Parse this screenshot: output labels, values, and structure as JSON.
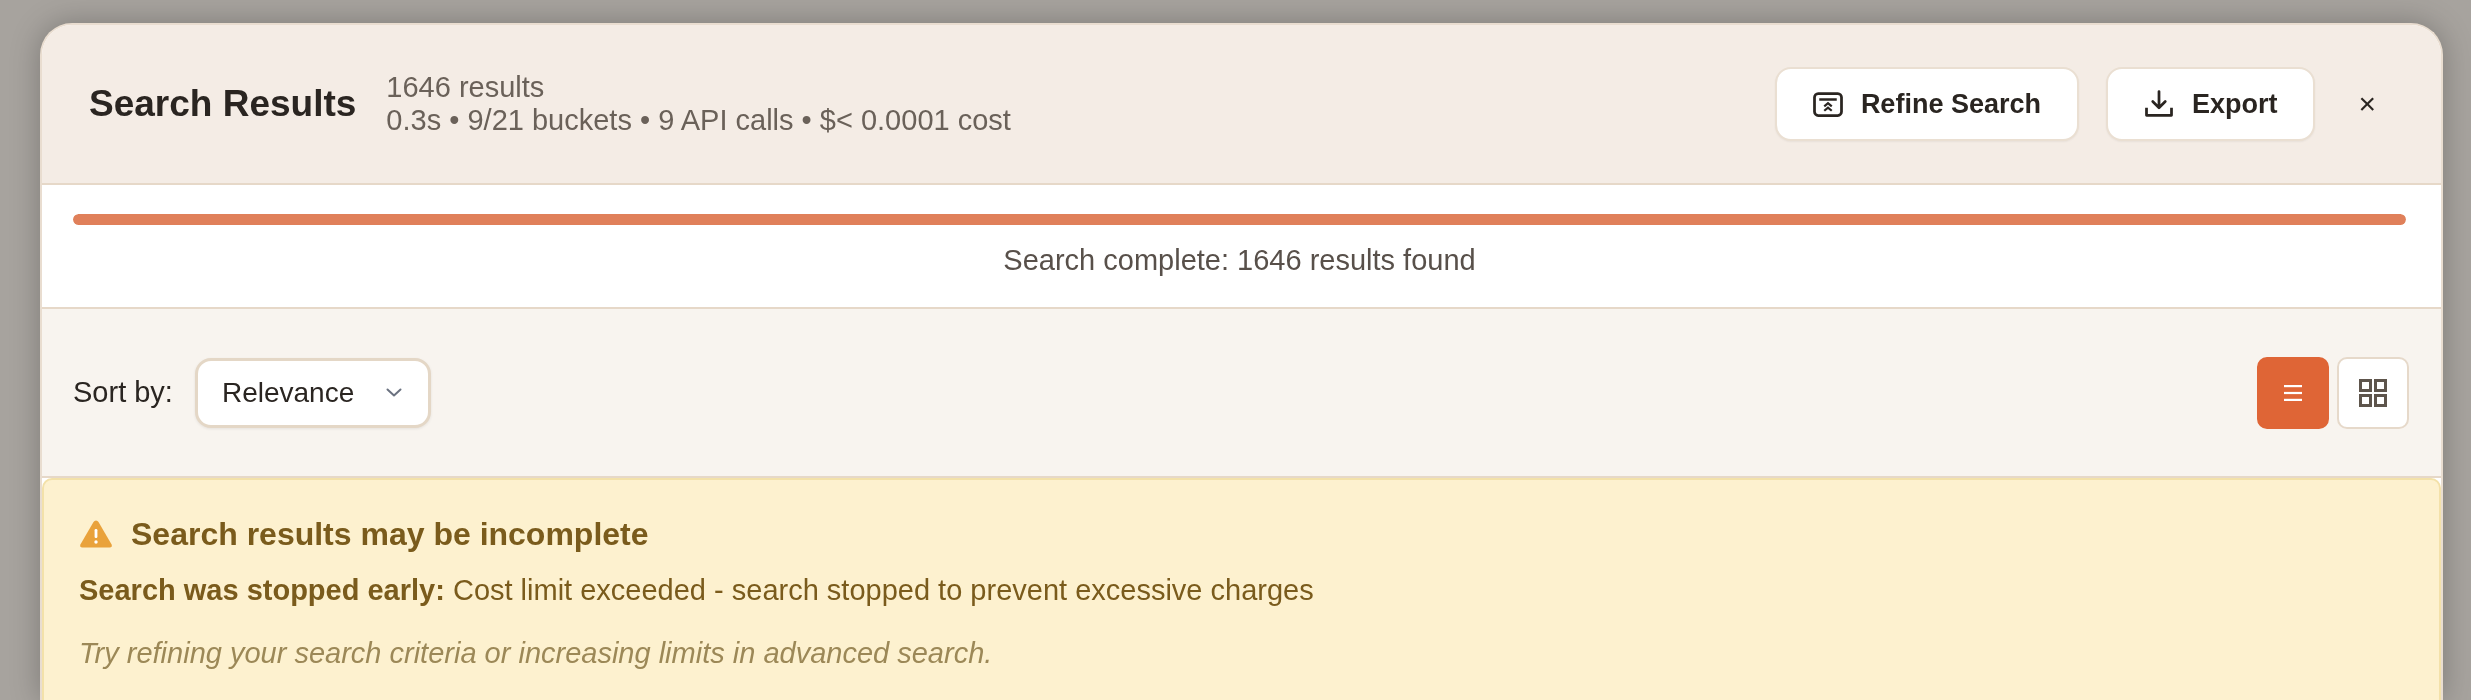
{
  "header": {
    "title": "Search Results",
    "result_count": "1646 results",
    "stats": "0.3s • 9/21 buckets • 9 API calls • $< 0.0001 cost",
    "buttons": [
      {
        "kind": "refine",
        "label": "Refine Search"
      },
      {
        "kind": "export",
        "label": "Export"
      }
    ],
    "close": "×"
  },
  "progress": {
    "level": 1,
    "status": "Search complete: 1646 results found"
  },
  "toolbar": {
    "sort_label": "Sort by:",
    "sort_value": "Relevance",
    "views": [
      {
        "kind": "list",
        "selected": true
      },
      {
        "kind": "grid",
        "selected": false
      }
    ]
  },
  "warning": {
    "title": "Search results may be incomplete",
    "message": "**Search was stopped early:** Cost limit exceeded - search stopped to prevent excessive charges",
    "hint": "Try refining your search criteria or increasing limits in advanced search."
  }
}
